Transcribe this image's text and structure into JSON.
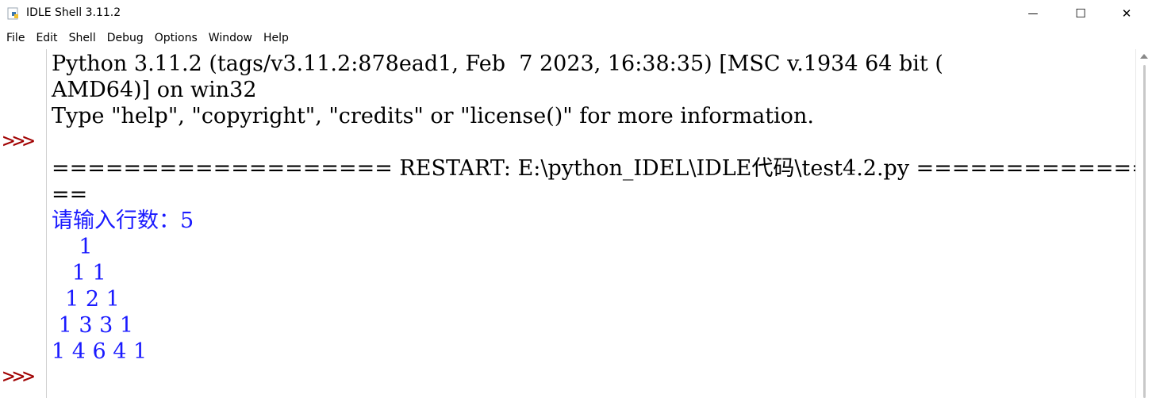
{
  "window": {
    "title": "IDLE Shell 3.11.2",
    "controls": {
      "minimize": "—",
      "maximize": "☐",
      "close": "✕"
    }
  },
  "menu": {
    "items": [
      "File",
      "Edit",
      "Shell",
      "Debug",
      "Options",
      "Window",
      "Help"
    ]
  },
  "shell": {
    "prompt": ">>>",
    "lines": [
      "Python 3.11.2 (tags/v3.11.2:878ead1, Feb  7 2023, 16:38:35) [MSC v.1934 64 bit (",
      "AMD64)] on win32",
      "Type \"help\", \"copyright\", \"credits\" or \"license()\" for more information.",
      "",
      "=================== RESTART: E:\\python_IDEL\\IDLE代码\\test4.2.py ================",
      "==",
      "请输入行数：5",
      "    1",
      "   1 1",
      "  1 2 1",
      " 1 3 3 1",
      "1 4 6 4 1"
    ]
  },
  "colors": {
    "prompt": "#a00000",
    "output": "#1a1aff",
    "text": "#000000"
  },
  "icons": {
    "app": "python-idle-icon",
    "scroll_up": "chevron-up-icon"
  }
}
